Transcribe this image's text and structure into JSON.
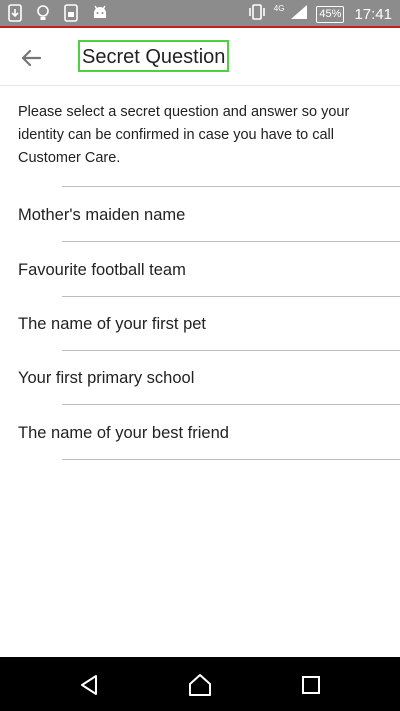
{
  "status_bar": {
    "battery": "45%",
    "time": "17:41",
    "network": "4G"
  },
  "app_bar": {
    "title": "Secret Question"
  },
  "intro_text": "Please select a secret question and answer so your identity can be confirmed in case you have to call Customer Care.",
  "questions": [
    "Mother's maiden name",
    "Favourite football team",
    "The name of your first pet",
    "Your first primary school",
    "The name of your best friend"
  ]
}
